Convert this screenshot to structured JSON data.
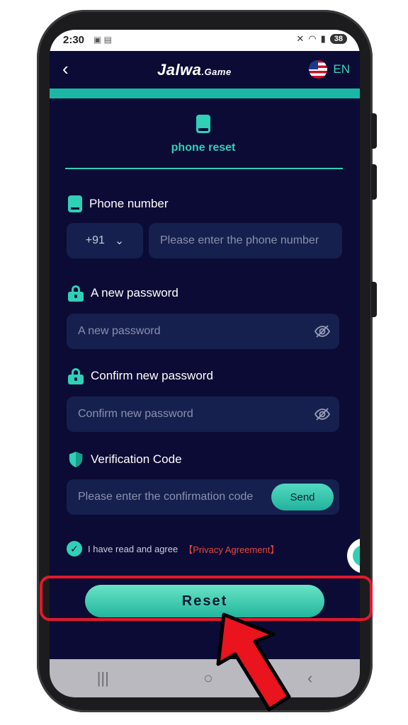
{
  "status_bar": {
    "time": "2:30",
    "battery": "38"
  },
  "header": {
    "back_icon": "chevron-left-icon",
    "brand": "Jalwa",
    "brand_suffix": ".Game",
    "language": "EN"
  },
  "tab": {
    "label": "phone reset"
  },
  "fields": {
    "phone": {
      "label": "Phone number",
      "country_code": "+91",
      "placeholder": "Please enter the phone number"
    },
    "new_password": {
      "label": "A new password",
      "placeholder": "A new password"
    },
    "confirm_password": {
      "label": "Confirm new password",
      "placeholder": "Confirm new password"
    },
    "verification": {
      "label": "Verification Code",
      "placeholder": "Please enter the confirmation code",
      "send_label": "Send"
    }
  },
  "agreement": {
    "text": "I have read and agree",
    "link": "【Privacy Agreement】"
  },
  "reset_label": "Reset",
  "colors": {
    "background": "#0c0b35",
    "accent": "#2fd0b6",
    "input": "#16204e",
    "link": "#e5493a",
    "highlight": "#e2192b"
  }
}
